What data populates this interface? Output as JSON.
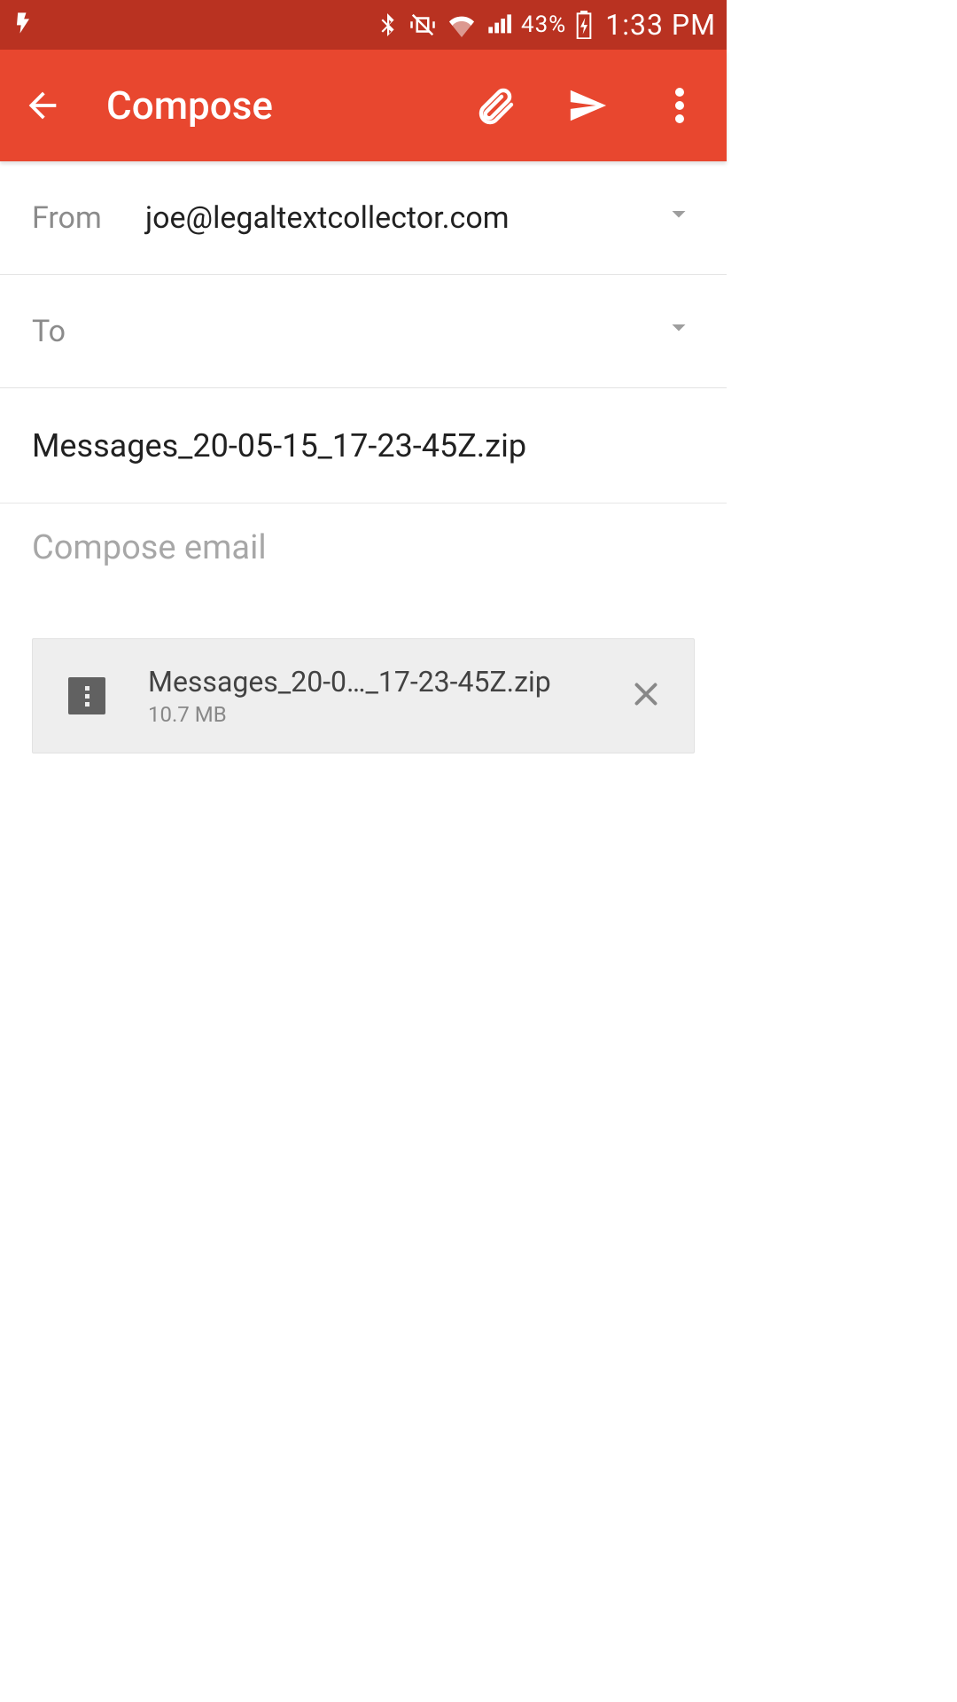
{
  "status_bar": {
    "battery_pct": "43%",
    "time": "1:33 PM"
  },
  "app_bar": {
    "title": "Compose"
  },
  "from": {
    "label": "From",
    "value": "joe@legaltextcollector.com"
  },
  "to": {
    "label": "To",
    "value": ""
  },
  "subject": {
    "value": "Messages_20-05-15_17-23-45Z.zip"
  },
  "body": {
    "placeholder": "Compose email",
    "value": ""
  },
  "attachment": {
    "name": "Messages_20-0…_17-23-45Z.zip",
    "size": "10.7 MB"
  }
}
